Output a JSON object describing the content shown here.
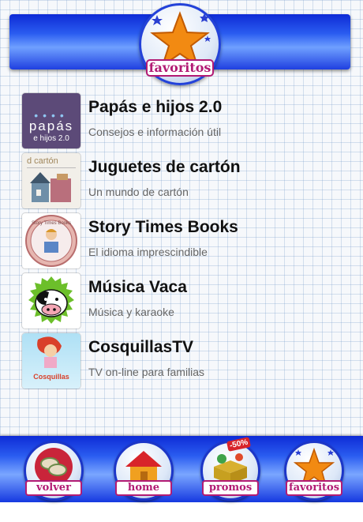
{
  "header": {
    "badge_label": "favoritos"
  },
  "items": [
    {
      "title": "Papás e hijos 2.0",
      "subtitle": "Consejos e información útil",
      "thumb_line1": "papás",
      "thumb_line2": "e hijos 2.0"
    },
    {
      "title": "Juguetes de cartón",
      "subtitle": "Un mundo de cartón",
      "thumb_line1": "d cartón"
    },
    {
      "title": "Story Times Books",
      "subtitle": "El idioma imprescindible",
      "thumb_line1": "Story Times Books"
    },
    {
      "title": "Música Vaca",
      "subtitle": "Música y karaoke"
    },
    {
      "title": "CosquillasTV",
      "subtitle": "TV on-line para familias",
      "thumb_line1": "Cosquillas"
    }
  ],
  "nav": {
    "back_label": "volver",
    "home_label": "home",
    "promos_label": "promos",
    "promos_badge": "-50%",
    "favorites_label": "favoritos"
  },
  "colors": {
    "bar_blue": "#1f3fe0",
    "label_magenta": "#b21b74",
    "star_orange": "#f28a12"
  }
}
